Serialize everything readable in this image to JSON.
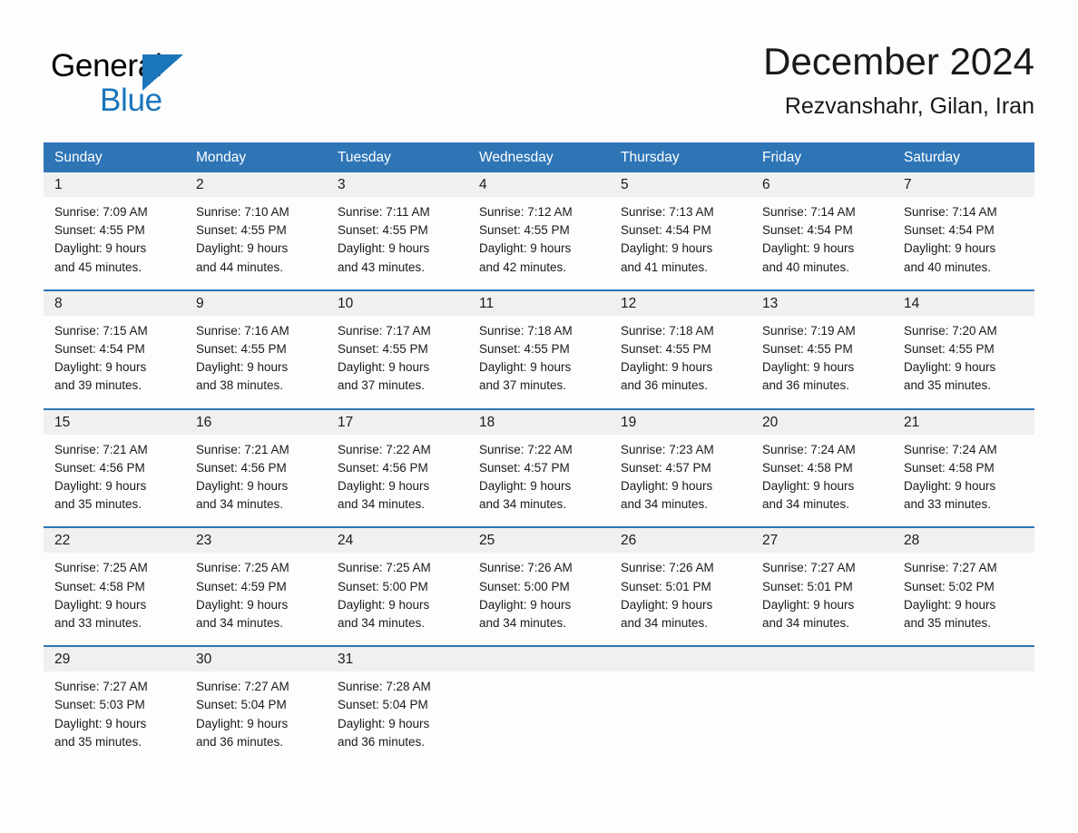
{
  "brand": {
    "name_part1": "General",
    "name_part2": "Blue",
    "triangle_color": "#1a75bb",
    "text_color": "#000000"
  },
  "header": {
    "title": "December 2024",
    "location": "Rezvanshahr, Gilan, Iran"
  },
  "theme": {
    "header_blue": "#2e75b6",
    "daynum_band": "#f0f0f0",
    "page_bg": "#fdfdfd",
    "text": "#1a1a1a"
  },
  "day_names": [
    "Sunday",
    "Monday",
    "Tuesday",
    "Wednesday",
    "Thursday",
    "Friday",
    "Saturday"
  ],
  "weeks": [
    [
      {
        "day": "1",
        "sunrise": "Sunrise: 7:09 AM",
        "sunset": "Sunset: 4:55 PM",
        "daylight1": "Daylight: 9 hours",
        "daylight2": "and 45 minutes."
      },
      {
        "day": "2",
        "sunrise": "Sunrise: 7:10 AM",
        "sunset": "Sunset: 4:55 PM",
        "daylight1": "Daylight: 9 hours",
        "daylight2": "and 44 minutes."
      },
      {
        "day": "3",
        "sunrise": "Sunrise: 7:11 AM",
        "sunset": "Sunset: 4:55 PM",
        "daylight1": "Daylight: 9 hours",
        "daylight2": "and 43 minutes."
      },
      {
        "day": "4",
        "sunrise": "Sunrise: 7:12 AM",
        "sunset": "Sunset: 4:55 PM",
        "daylight1": "Daylight: 9 hours",
        "daylight2": "and 42 minutes."
      },
      {
        "day": "5",
        "sunrise": "Sunrise: 7:13 AM",
        "sunset": "Sunset: 4:54 PM",
        "daylight1": "Daylight: 9 hours",
        "daylight2": "and 41 minutes."
      },
      {
        "day": "6",
        "sunrise": "Sunrise: 7:14 AM",
        "sunset": "Sunset: 4:54 PM",
        "daylight1": "Daylight: 9 hours",
        "daylight2": "and 40 minutes."
      },
      {
        "day": "7",
        "sunrise": "Sunrise: 7:14 AM",
        "sunset": "Sunset: 4:54 PM",
        "daylight1": "Daylight: 9 hours",
        "daylight2": "and 40 minutes."
      }
    ],
    [
      {
        "day": "8",
        "sunrise": "Sunrise: 7:15 AM",
        "sunset": "Sunset: 4:54 PM",
        "daylight1": "Daylight: 9 hours",
        "daylight2": "and 39 minutes."
      },
      {
        "day": "9",
        "sunrise": "Sunrise: 7:16 AM",
        "sunset": "Sunset: 4:55 PM",
        "daylight1": "Daylight: 9 hours",
        "daylight2": "and 38 minutes."
      },
      {
        "day": "10",
        "sunrise": "Sunrise: 7:17 AM",
        "sunset": "Sunset: 4:55 PM",
        "daylight1": "Daylight: 9 hours",
        "daylight2": "and 37 minutes."
      },
      {
        "day": "11",
        "sunrise": "Sunrise: 7:18 AM",
        "sunset": "Sunset: 4:55 PM",
        "daylight1": "Daylight: 9 hours",
        "daylight2": "and 37 minutes."
      },
      {
        "day": "12",
        "sunrise": "Sunrise: 7:18 AM",
        "sunset": "Sunset: 4:55 PM",
        "daylight1": "Daylight: 9 hours",
        "daylight2": "and 36 minutes."
      },
      {
        "day": "13",
        "sunrise": "Sunrise: 7:19 AM",
        "sunset": "Sunset: 4:55 PM",
        "daylight1": "Daylight: 9 hours",
        "daylight2": "and 36 minutes."
      },
      {
        "day": "14",
        "sunrise": "Sunrise: 7:20 AM",
        "sunset": "Sunset: 4:55 PM",
        "daylight1": "Daylight: 9 hours",
        "daylight2": "and 35 minutes."
      }
    ],
    [
      {
        "day": "15",
        "sunrise": "Sunrise: 7:21 AM",
        "sunset": "Sunset: 4:56 PM",
        "daylight1": "Daylight: 9 hours",
        "daylight2": "and 35 minutes."
      },
      {
        "day": "16",
        "sunrise": "Sunrise: 7:21 AM",
        "sunset": "Sunset: 4:56 PM",
        "daylight1": "Daylight: 9 hours",
        "daylight2": "and 34 minutes."
      },
      {
        "day": "17",
        "sunrise": "Sunrise: 7:22 AM",
        "sunset": "Sunset: 4:56 PM",
        "daylight1": "Daylight: 9 hours",
        "daylight2": "and 34 minutes."
      },
      {
        "day": "18",
        "sunrise": "Sunrise: 7:22 AM",
        "sunset": "Sunset: 4:57 PM",
        "daylight1": "Daylight: 9 hours",
        "daylight2": "and 34 minutes."
      },
      {
        "day": "19",
        "sunrise": "Sunrise: 7:23 AM",
        "sunset": "Sunset: 4:57 PM",
        "daylight1": "Daylight: 9 hours",
        "daylight2": "and 34 minutes."
      },
      {
        "day": "20",
        "sunrise": "Sunrise: 7:24 AM",
        "sunset": "Sunset: 4:58 PM",
        "daylight1": "Daylight: 9 hours",
        "daylight2": "and 34 minutes."
      },
      {
        "day": "21",
        "sunrise": "Sunrise: 7:24 AM",
        "sunset": "Sunset: 4:58 PM",
        "daylight1": "Daylight: 9 hours",
        "daylight2": "and 33 minutes."
      }
    ],
    [
      {
        "day": "22",
        "sunrise": "Sunrise: 7:25 AM",
        "sunset": "Sunset: 4:58 PM",
        "daylight1": "Daylight: 9 hours",
        "daylight2": "and 33 minutes."
      },
      {
        "day": "23",
        "sunrise": "Sunrise: 7:25 AM",
        "sunset": "Sunset: 4:59 PM",
        "daylight1": "Daylight: 9 hours",
        "daylight2": "and 34 minutes."
      },
      {
        "day": "24",
        "sunrise": "Sunrise: 7:25 AM",
        "sunset": "Sunset: 5:00 PM",
        "daylight1": "Daylight: 9 hours",
        "daylight2": "and 34 minutes."
      },
      {
        "day": "25",
        "sunrise": "Sunrise: 7:26 AM",
        "sunset": "Sunset: 5:00 PM",
        "daylight1": "Daylight: 9 hours",
        "daylight2": "and 34 minutes."
      },
      {
        "day": "26",
        "sunrise": "Sunrise: 7:26 AM",
        "sunset": "Sunset: 5:01 PM",
        "daylight1": "Daylight: 9 hours",
        "daylight2": "and 34 minutes."
      },
      {
        "day": "27",
        "sunrise": "Sunrise: 7:27 AM",
        "sunset": "Sunset: 5:01 PM",
        "daylight1": "Daylight: 9 hours",
        "daylight2": "and 34 minutes."
      },
      {
        "day": "28",
        "sunrise": "Sunrise: 7:27 AM",
        "sunset": "Sunset: 5:02 PM",
        "daylight1": "Daylight: 9 hours",
        "daylight2": "and 35 minutes."
      }
    ],
    [
      {
        "day": "29",
        "sunrise": "Sunrise: 7:27 AM",
        "sunset": "Sunset: 5:03 PM",
        "daylight1": "Daylight: 9 hours",
        "daylight2": "and 35 minutes."
      },
      {
        "day": "30",
        "sunrise": "Sunrise: 7:27 AM",
        "sunset": "Sunset: 5:04 PM",
        "daylight1": "Daylight: 9 hours",
        "daylight2": "and 36 minutes."
      },
      {
        "day": "31",
        "sunrise": "Sunrise: 7:28 AM",
        "sunset": "Sunset: 5:04 PM",
        "daylight1": "Daylight: 9 hours",
        "daylight2": "and 36 minutes."
      },
      {
        "day": "",
        "sunrise": "",
        "sunset": "",
        "daylight1": "",
        "daylight2": ""
      },
      {
        "day": "",
        "sunrise": "",
        "sunset": "",
        "daylight1": "",
        "daylight2": ""
      },
      {
        "day": "",
        "sunrise": "",
        "sunset": "",
        "daylight1": "",
        "daylight2": ""
      },
      {
        "day": "",
        "sunrise": "",
        "sunset": "",
        "daylight1": "",
        "daylight2": ""
      }
    ]
  ]
}
